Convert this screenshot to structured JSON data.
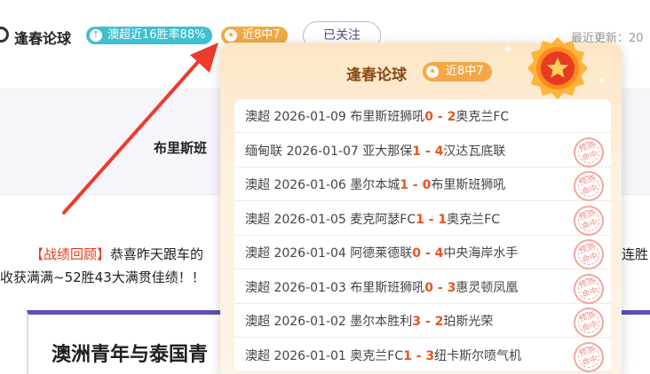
{
  "header": {
    "name": "逢春论球",
    "streak_badge": "澳超近16胜率88%",
    "recent_badge": "近8中7",
    "follow_label": "已关注",
    "updated_label": "最近更新：20"
  },
  "background": {
    "match_title": "布里斯班",
    "para1_bracket": "【战绩回顾】",
    "para1_text": "恭喜昨天跟车的",
    "para1_right": "连胜",
    "para2_text": "收获满满~52胜43大满贯佳绩！！",
    "article_title": "澳洲青年与泰国青"
  },
  "popup": {
    "title": "逢春论球",
    "badge": "近8中7",
    "stamp_text": [
      "预测",
      "命中"
    ],
    "records": [
      {
        "league": "澳超",
        "date": "2026-01-09",
        "home": "布里斯班狮吼",
        "home_score": "0",
        "sep": " - ",
        "away_score": "2",
        "away": "奥克兰FC",
        "hit": false
      },
      {
        "league": "缅甸联",
        "date": "2026-01-07",
        "home": "亚大那保",
        "home_score": "1",
        "sep": " - ",
        "away_score": "4",
        "away": "汉达瓦底联",
        "hit": true
      },
      {
        "league": "澳超",
        "date": "2026-01-06",
        "home": "墨尔本城",
        "home_score": "1",
        "sep": " - ",
        "away_score": "0",
        "away": "布里斯班狮吼",
        "hit": true
      },
      {
        "league": "澳超",
        "date": "2026-01-05",
        "home": "麦克阿瑟FC",
        "home_score": "1",
        "sep": " - ",
        "away_score": "1",
        "away": "奥克兰FC",
        "hit": true
      },
      {
        "league": "澳超",
        "date": "2026-01-04",
        "home": "阿德莱德联",
        "home_score": "0",
        "sep": " - ",
        "away_score": "4",
        "away": "中央海岸水手",
        "hit": true
      },
      {
        "league": "澳超",
        "date": "2026-01-03",
        "home": "布里斯班狮吼",
        "home_score": "0",
        "sep": " - ",
        "away_score": "3",
        "away": "惠灵顿凤凰",
        "hit": true
      },
      {
        "league": "澳超",
        "date": "2026-01-02",
        "home": "墨尔本胜利",
        "home_score": "3",
        "sep": " - ",
        "away_score": "2",
        "away": "珀斯光荣",
        "hit": true
      },
      {
        "league": "澳超",
        "date": "2026-01-01",
        "home": "奥克兰FC",
        "home_score": "1",
        "sep": " - ",
        "away_score": "3",
        "away": "纽卡斯尔喷气机",
        "hit": true
      }
    ]
  },
  "colors": {
    "streak": "#3fc0d1",
    "recent": "#f4a845",
    "score": "#e8531c",
    "arrow": "#ee3b2b",
    "accent_bar": "#5b4fb8"
  }
}
